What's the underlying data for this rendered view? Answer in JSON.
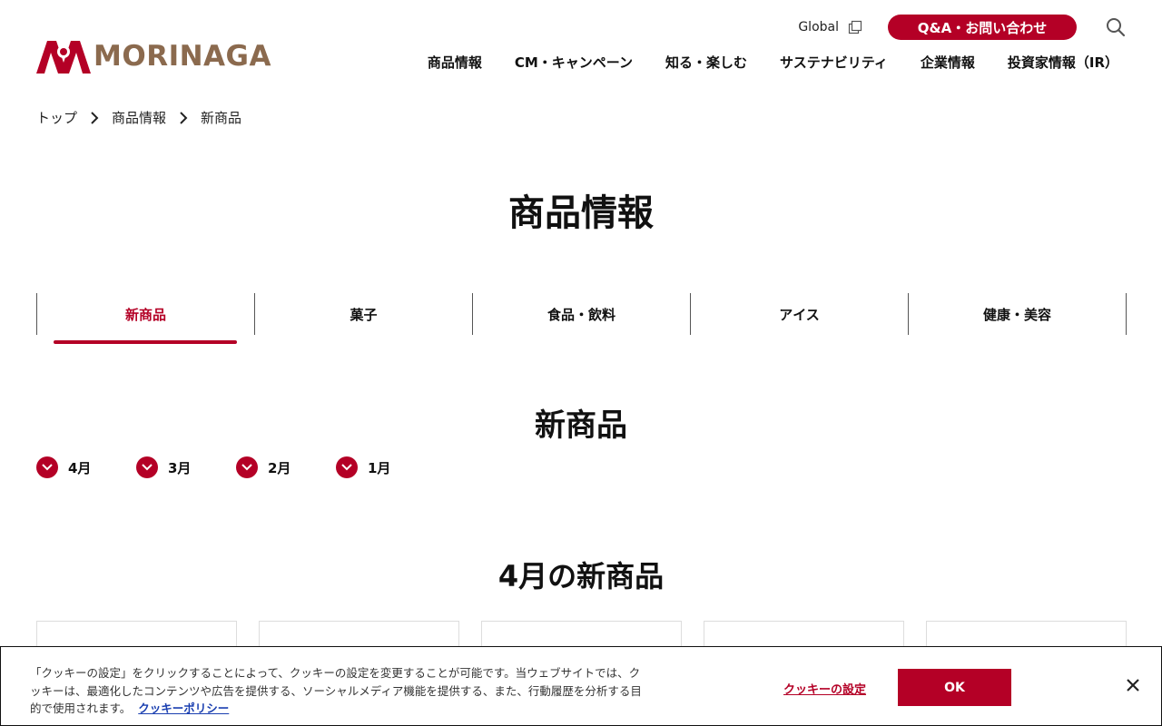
{
  "brand": {
    "logo_text": "MORINAGA",
    "accent": "#b40026",
    "logo_color": "#8b6a4e"
  },
  "header": {
    "global_label": "Global",
    "qa_label": "Q&A・お問い合わせ",
    "nav": [
      "商品情報",
      "CM・キャンペーン",
      "知る・楽しむ",
      "サステナビリティ",
      "企業情報",
      "投資家情報（IR）"
    ]
  },
  "breadcrumb": [
    "トップ",
    "商品情報",
    "新商品"
  ],
  "page_title": "商品情報",
  "tabs": [
    {
      "label": "新商品",
      "active": true
    },
    {
      "label": "菓子",
      "active": false
    },
    {
      "label": "食品・飲料",
      "active": false
    },
    {
      "label": "アイス",
      "active": false
    },
    {
      "label": "健康・美容",
      "active": false
    }
  ],
  "section_title": "新商品",
  "months": [
    "4月",
    "3月",
    "2月",
    "1月"
  ],
  "sub_title": "4月の新商品",
  "cookie": {
    "text": "「クッキーの設定」をクリックすることによって、クッキーの設定を変更することが可能です。当ウェブサイトでは、クッキーは、最適化したコンテンツや広告を提供する、ソーシャルメディア機能を提供する、また、行動履歴を分析する目的で使用されます。",
    "policy_link": "クッキーポリシー",
    "settings_label": "クッキーの設定",
    "ok_label": "OK"
  },
  "icons": {
    "logo": "morinaga-angel-logo-icon",
    "external": "external-window-icon",
    "search": "search-icon",
    "chevron": "chevron-right-icon",
    "month": "chevron-down-circle-icon",
    "close": "close-icon"
  }
}
